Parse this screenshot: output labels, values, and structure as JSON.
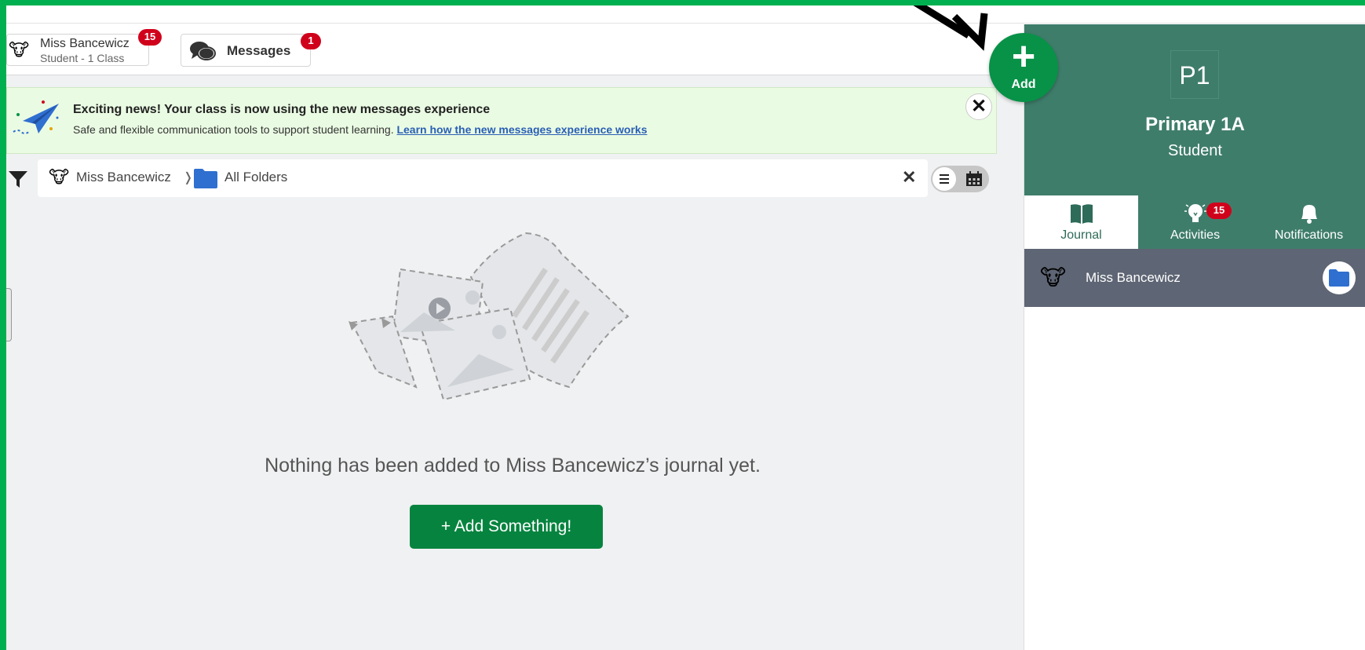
{
  "header": {
    "user": {
      "name": "Miss Bancewicz",
      "subtitle": "Student - 1 Class",
      "badge": "15"
    },
    "messages": {
      "label": "Messages",
      "badge": "1"
    }
  },
  "banner": {
    "title": "Exciting news! Your class is now using the new messages experience",
    "text": "Safe and flexible communication tools to support student learning.",
    "link": "Learn how the new messages experience works",
    "close": "✕"
  },
  "breadcrumb": {
    "student": "Miss Bancewicz",
    "separator": "❭",
    "folder": "All Folders",
    "clear": "✕"
  },
  "empty_state": {
    "message": "Nothing has been added to Miss Bancewicz’s journal yet.",
    "button": "+ Add Something!"
  },
  "fab": {
    "plus": "+",
    "label": "Add"
  },
  "sidebar": {
    "class_tile": "P1",
    "class_name": "Primary 1A",
    "role": "Student",
    "tabs": [
      {
        "label": "Journal",
        "icon": "book-icon"
      },
      {
        "label": "Activities",
        "icon": "lightbulb-icon",
        "badge": "15"
      },
      {
        "label": "Notifications",
        "icon": "bell-icon"
      }
    ],
    "student_row": {
      "name": "Miss Bancewicz"
    }
  },
  "icons": {
    "avatar": "🐮"
  },
  "colors": {
    "frame": "#00b050",
    "primary_green": "#079247",
    "sidebar_teal": "#3f7d6b",
    "badge_red": "#d0021b",
    "link_blue": "#2a5fb5",
    "folder_blue": "#2f6fd0"
  }
}
